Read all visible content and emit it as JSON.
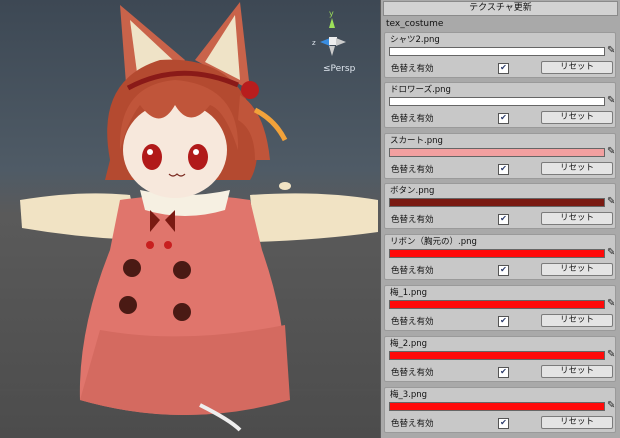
{
  "scene": {
    "persp_label": "≤Persp",
    "gizmo_axis_y": "y",
    "gizmo_axis_z": "z"
  },
  "panel": {
    "title": "テクスチャ更新",
    "section": "tex_costume",
    "enable_label": "色替え有効",
    "reset_label": "リセット",
    "items": [
      {
        "name": "シャツ2.png",
        "color": "#ffffff",
        "checked": "✔"
      },
      {
        "name": "ドロワーズ.png",
        "color": "#ffffff",
        "checked": "✔"
      },
      {
        "name": "スカート.png",
        "color": "#f2a0a0",
        "checked": "✔"
      },
      {
        "name": "ボタン.png",
        "color": "#7a1a12",
        "checked": "✔"
      },
      {
        "name": "リボン（胸元の）.png",
        "color": "#ff0a0a",
        "checked": "✔"
      },
      {
        "name": "梅_1.png",
        "color": "#ff0a0a",
        "checked": "✔"
      },
      {
        "name": "梅_2.png",
        "color": "#ff0a0a",
        "checked": "✔"
      },
      {
        "name": "梅_3.png",
        "color": "#ff0a0a",
        "checked": "✔"
      }
    ]
  }
}
